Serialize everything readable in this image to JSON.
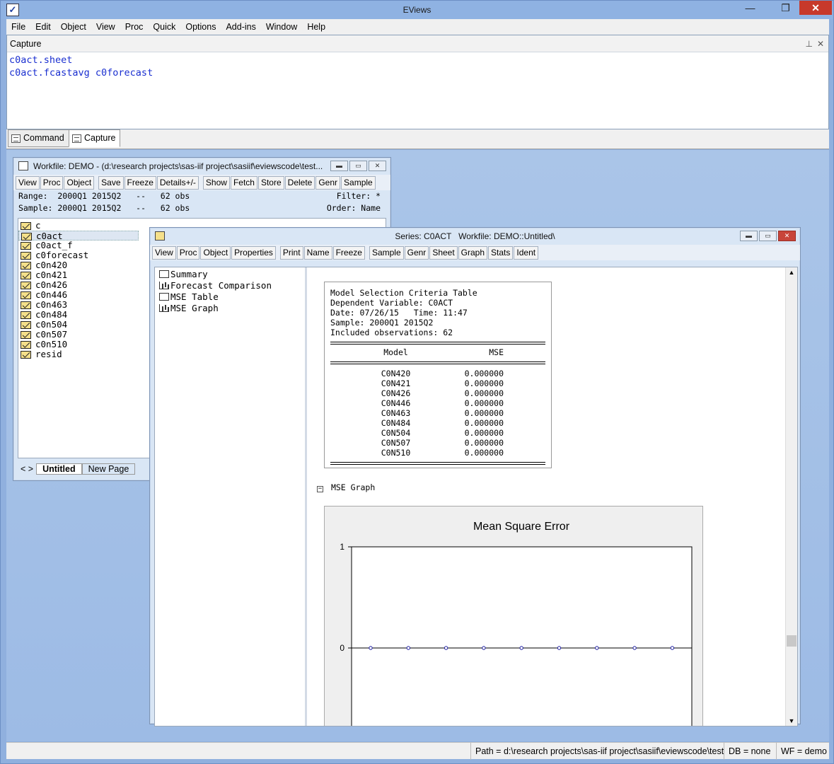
{
  "app": {
    "title": "EViews"
  },
  "menu": [
    "File",
    "Edit",
    "Object",
    "View",
    "Proc",
    "Quick",
    "Options",
    "Add-ins",
    "Window",
    "Help"
  ],
  "capture": {
    "title": "Capture",
    "lines": [
      "c0act.sheet",
      "c0act.fcastavg c0forecast"
    ]
  },
  "bottom_tabs": [
    "Command",
    "Capture"
  ],
  "workfile": {
    "title": "Workfile: DEMO - (d:\\research projects\\sas-iif project\\sasiif\\eviewscode\\test...",
    "toolbar": [
      "View",
      "Proc",
      "Object",
      "Save",
      "Freeze",
      "Details+/-",
      "Show",
      "Fetch",
      "Store",
      "Delete",
      "Genr",
      "Sample"
    ],
    "range_line": "Range:  2000Q1 2015Q2   --   62 obs",
    "filter_line": "Filter: *",
    "sample_line": "Sample: 2000Q1 2015Q2   --   62 obs",
    "order_line": "Order: Name",
    "items": [
      {
        "name": "c",
        "icon": "beta"
      },
      {
        "name": "c0act",
        "icon": "series"
      },
      {
        "name": "c0act_f",
        "icon": "series"
      },
      {
        "name": "c0forecast",
        "icon": "group"
      },
      {
        "name": "c0n420",
        "icon": "series"
      },
      {
        "name": "c0n421",
        "icon": "series"
      },
      {
        "name": "c0n426",
        "icon": "series"
      },
      {
        "name": "c0n446",
        "icon": "series"
      },
      {
        "name": "c0n463",
        "icon": "series"
      },
      {
        "name": "c0n484",
        "icon": "series"
      },
      {
        "name": "c0n504",
        "icon": "series"
      },
      {
        "name": "c0n507",
        "icon": "series"
      },
      {
        "name": "c0n510",
        "icon": "series"
      },
      {
        "name": "resid",
        "icon": "series"
      }
    ],
    "page_tabs": [
      "Untitled",
      "New Page"
    ],
    "page_nav": "< >"
  },
  "series": {
    "title": "Series: C0ACT   Workfile: DEMO::Untitled\\",
    "toolbar": [
      "View",
      "Proc",
      "Object",
      "Properties",
      "Print",
      "Name",
      "Freeze",
      "Sample",
      "Genr",
      "Sheet",
      "Graph",
      "Stats",
      "Ident"
    ],
    "tree": [
      {
        "label": "Summary",
        "icon": "table"
      },
      {
        "label": "Forecast Comparison",
        "icon": "graph"
      },
      {
        "label": "MSE Table",
        "icon": "table"
      },
      {
        "label": "MSE Graph",
        "icon": "graph"
      }
    ],
    "table": {
      "header_lines": [
        "Model Selection Criteria Table",
        "Dependent Variable: C0ACT",
        "Date: 07/26/15   Time: 11:47",
        "Sample: 2000Q1 2015Q2",
        "Included observations: 62"
      ],
      "col_model": "Model",
      "col_mse": "MSE",
      "rows": [
        {
          "model": "C0N420",
          "mse": "0.000000"
        },
        {
          "model": "C0N421",
          "mse": "0.000000"
        },
        {
          "model": "C0N426",
          "mse": "0.000000"
        },
        {
          "model": "C0N446",
          "mse": "0.000000"
        },
        {
          "model": "C0N463",
          "mse": "0.000000"
        },
        {
          "model": "C0N484",
          "mse": "0.000000"
        },
        {
          "model": "C0N504",
          "mse": "0.000000"
        },
        {
          "model": "C0N507",
          "mse": "0.000000"
        },
        {
          "model": "C0N510",
          "mse": "0.000000"
        }
      ]
    },
    "graph_section_label": "MSE Graph"
  },
  "chart_data": {
    "type": "line",
    "title": "Mean Square Error",
    "x": [
      1,
      2,
      3,
      4,
      5,
      6,
      7,
      8,
      9
    ],
    "series": [
      {
        "values": [
          0,
          0,
          0,
          0,
          0,
          0,
          0,
          0,
          0
        ]
      }
    ],
    "yticks": [
      "1",
      "0"
    ],
    "ylim": [
      -1,
      1
    ]
  },
  "status": {
    "path": "Path = d:\\research projects\\sas-iif project\\sasiif\\eviewscode\\test",
    "db": "DB = none",
    "wf": "WF = demo"
  },
  "colors": {
    "capture_text": "#1a2fd0",
    "close_button": "#c7392b",
    "point_marker": "#1a1aa0"
  }
}
